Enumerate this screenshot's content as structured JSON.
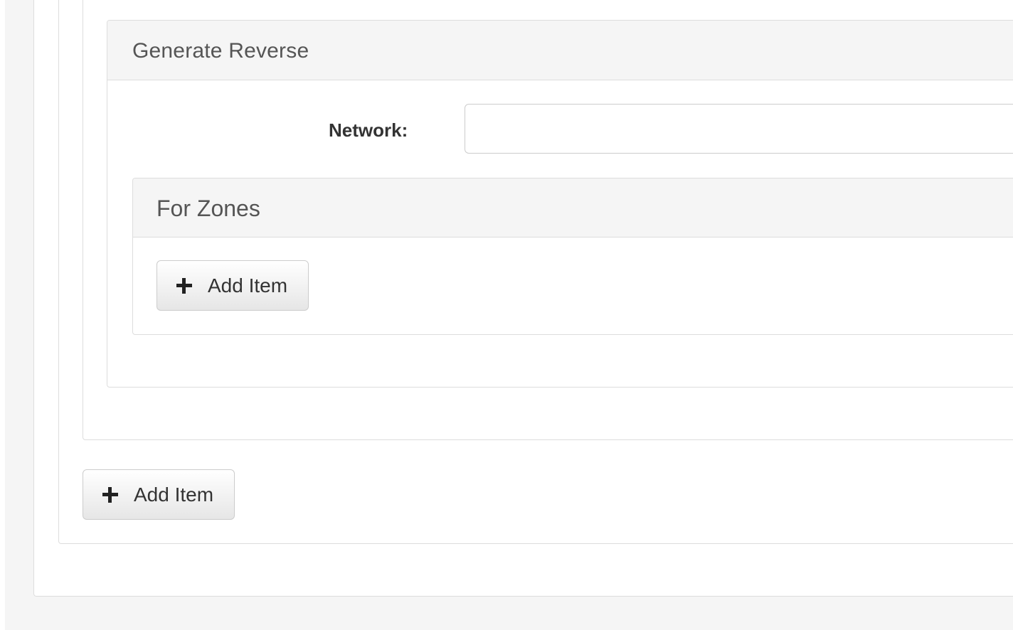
{
  "reverse_section": {
    "title": "Generate Reverse",
    "network_label": "Network:",
    "network_value": "",
    "network_placeholder": ""
  },
  "zones_section": {
    "title": "For Zones",
    "add_item_label": "Add Item",
    "add_item_icon": "plus-icon"
  },
  "outer_section": {
    "add_item_label": "Add Item",
    "add_item_icon": "plus-icon"
  }
}
